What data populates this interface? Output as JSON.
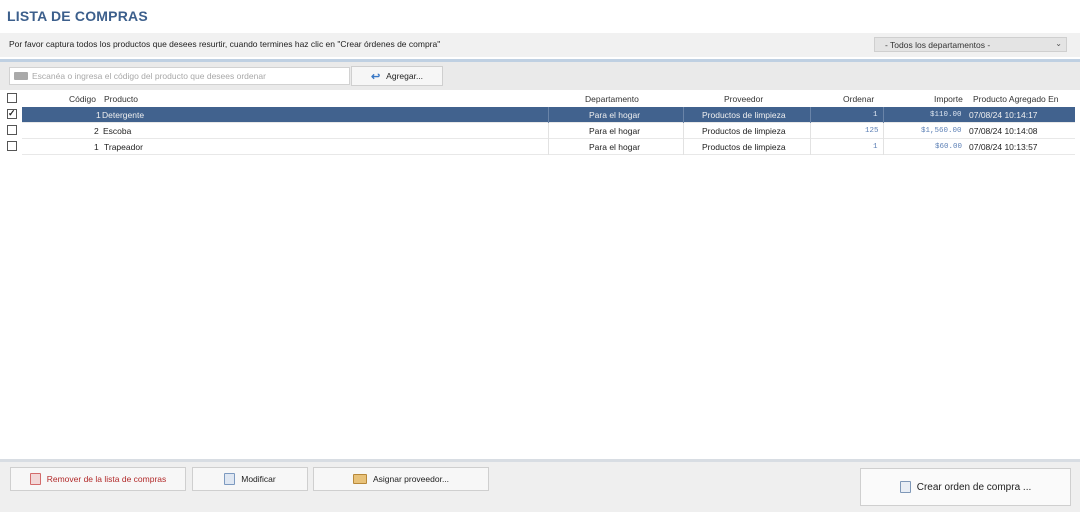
{
  "app": {
    "title": "LISTA DE COMPRAS"
  },
  "instructions": "Por favor captura todos los productos que desees resurtir, cuando termines haz clic en \"Crear órdenes de compra\"",
  "department_filter": {
    "selected": "- Todos los departamentos -"
  },
  "search": {
    "placeholder": "Escanéa o ingresa el código del producto que desees ordenar"
  },
  "toolbar": {
    "add_label": "Agregar..."
  },
  "columns": {
    "code": "Código",
    "product": "Producto",
    "department": "Departamento",
    "supplier": "Proveedor",
    "order": "Ordenar",
    "amount": "Importe",
    "added": "Producto Agregado En"
  },
  "rows": [
    {
      "checked": true,
      "code": "1",
      "product": "Detergente",
      "department": "Para el hogar",
      "supplier": "Productos de limpieza",
      "order": "1",
      "amount": "$110.00",
      "added": "07/08/24 10:14:17"
    },
    {
      "checked": false,
      "code": "2",
      "product": "Escoba",
      "department": "Para el hogar",
      "supplier": "Productos de limpieza",
      "order": "125",
      "amount": "$1,560.00",
      "added": "07/08/24 10:14:08"
    },
    {
      "checked": false,
      "code": "1",
      "product": "Trapeador",
      "department": "Para el hogar",
      "supplier": "Productos de limpieza",
      "order": "1",
      "amount": "$60.00",
      "added": "07/08/24 10:13:57"
    }
  ],
  "actions": {
    "remove": "Remover de la lista de compras",
    "modify": "Modificar",
    "assign": "Asignar proveedor...",
    "create": "Crear orden de compra ..."
  },
  "colors": {
    "accent": "#3c5f8c",
    "selected_row": "#41628e",
    "remove_text": "#b22a2a"
  }
}
